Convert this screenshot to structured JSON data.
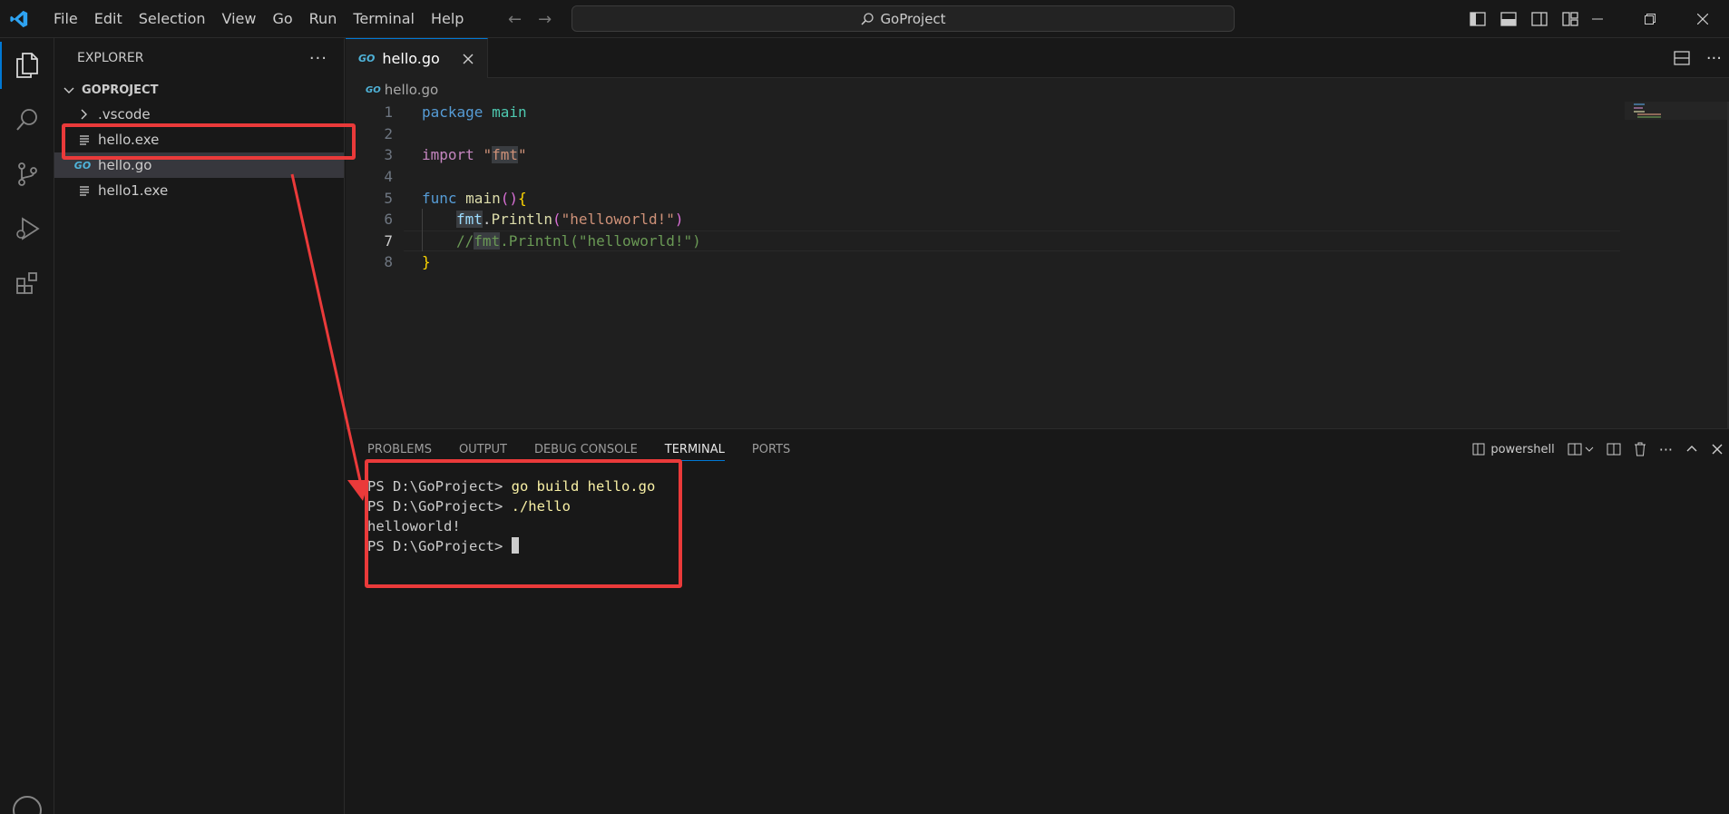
{
  "menu": [
    "File",
    "Edit",
    "Selection",
    "View",
    "Go",
    "Run",
    "Terminal",
    "Help"
  ],
  "search": {
    "text": "GoProject"
  },
  "explorer": {
    "title": "EXPLORER",
    "more": "···",
    "section": "GOPROJECT",
    "items": [
      {
        "label": ".vscode",
        "kind": "folder"
      },
      {
        "label": "hello.exe",
        "kind": "file"
      },
      {
        "label": "hello.go",
        "kind": "go"
      },
      {
        "label": "hello1.exe",
        "kind": "file"
      }
    ]
  },
  "editor": {
    "tab_label": "hello.go",
    "breadcrumb": "hello.go",
    "line_numbers": [
      "1",
      "2",
      "3",
      "4",
      "5",
      "6",
      "7",
      "8"
    ],
    "current_line": 7,
    "code": {
      "l1_kw": "package",
      "l1_name": "main",
      "l3_kw": "import",
      "l3_q1": "\"",
      "l3_pkg": "fmt",
      "l3_q2": "\"",
      "l5_kw": "func",
      "l5_fn": "main",
      "l5_paren": "()",
      "l5_brace": "{",
      "l6_pkg": "fmt",
      "l6_dot": ".",
      "l6_fn": "Println",
      "l6_po": "(",
      "l6_str": "\"helloworld!\"",
      "l6_pc": ")",
      "l7_slash": "//",
      "l7_pkg": "fmt",
      "l7_rest": ".Printnl(\"helloworld!\")",
      "l8_brace": "}"
    }
  },
  "panel": {
    "tabs": [
      "PROBLEMS",
      "OUTPUT",
      "DEBUG CONSOLE",
      "TERMINAL",
      "PORTS"
    ],
    "active_tab": "TERMINAL",
    "shell": "powershell",
    "terminal": {
      "prompt": "PS D:\\GoProject> ",
      "cmd1": "go build hello.go",
      "cmd2": "./hello",
      "output": "helloworld!"
    }
  },
  "colors": {
    "annotation": "#ea3a3a",
    "accent": "#0078d4"
  }
}
